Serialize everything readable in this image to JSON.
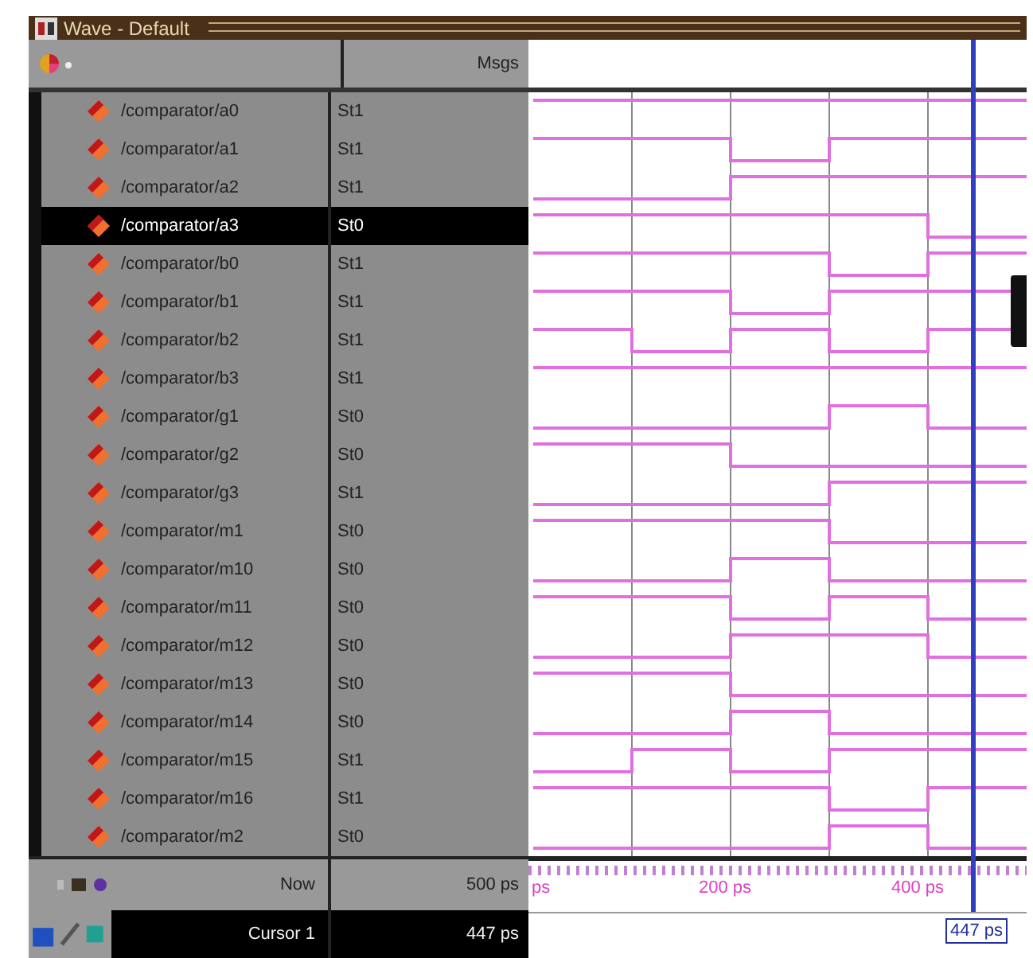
{
  "window": {
    "title": "Wave - Default"
  },
  "columns": {
    "value_heading": "Msgs"
  },
  "signals": [
    {
      "name": "/comparator/a0",
      "value": "St1",
      "selected": false
    },
    {
      "name": "/comparator/a1",
      "value": "St1",
      "selected": false
    },
    {
      "name": "/comparator/a2",
      "value": "St1",
      "selected": false
    },
    {
      "name": "/comparator/a3",
      "value": "St0",
      "selected": true
    },
    {
      "name": "/comparator/b0",
      "value": "St1",
      "selected": false
    },
    {
      "name": "/comparator/b1",
      "value": "St1",
      "selected": false
    },
    {
      "name": "/comparator/b2",
      "value": "St1",
      "selected": false
    },
    {
      "name": "/comparator/b3",
      "value": "St1",
      "selected": false
    },
    {
      "name": "/comparator/g1",
      "value": "St0",
      "selected": false
    },
    {
      "name": "/comparator/g2",
      "value": "St0",
      "selected": false
    },
    {
      "name": "/comparator/g3",
      "value": "St1",
      "selected": false
    },
    {
      "name": "/comparator/m1",
      "value": "St0",
      "selected": false
    },
    {
      "name": "/comparator/m10",
      "value": "St0",
      "selected": false
    },
    {
      "name": "/comparator/m11",
      "value": "St0",
      "selected": false
    },
    {
      "name": "/comparator/m12",
      "value": "St0",
      "selected": false
    },
    {
      "name": "/comparator/m13",
      "value": "St0",
      "selected": false
    },
    {
      "name": "/comparator/m14",
      "value": "St0",
      "selected": false
    },
    {
      "name": "/comparator/m15",
      "value": "St1",
      "selected": false
    },
    {
      "name": "/comparator/m16",
      "value": "St1",
      "selected": false
    },
    {
      "name": "/comparator/m2",
      "value": "St0",
      "selected": false
    }
  ],
  "now": {
    "label": "Now",
    "value": "500 ps"
  },
  "cursor": {
    "label": "Cursor 1",
    "value": "447 ps",
    "marker": "447 ps"
  },
  "time_axis": {
    "labels": [
      "ps",
      "200 ps",
      "400 ps"
    ]
  }
}
